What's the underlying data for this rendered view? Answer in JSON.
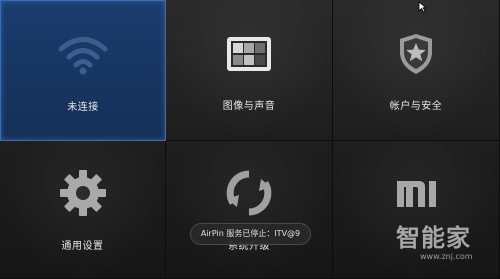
{
  "tiles": [
    {
      "label": "未连接",
      "icon": "wifi-icon",
      "focused": true
    },
    {
      "label": "图像与声音",
      "icon": "display-icon",
      "focused": false
    },
    {
      "label": "帐户与安全",
      "icon": "shield-star-icon",
      "focused": false
    },
    {
      "label": "通用设置",
      "icon": "gear-icon",
      "focused": false
    },
    {
      "label": "系统升级",
      "icon": "sync-icon",
      "focused": false
    },
    {
      "label": "MI",
      "icon": "mi-logo-icon",
      "focused": false
    }
  ],
  "toast": {
    "text": "AirPin 服务已停止：ITV@9"
  },
  "watermark": {
    "text": "智能家",
    "url": "www.znj.com"
  },
  "colors": {
    "focus": "#1a3c6e",
    "focus_border": "#3b6bb0",
    "icon": "#8e8e8e"
  }
}
